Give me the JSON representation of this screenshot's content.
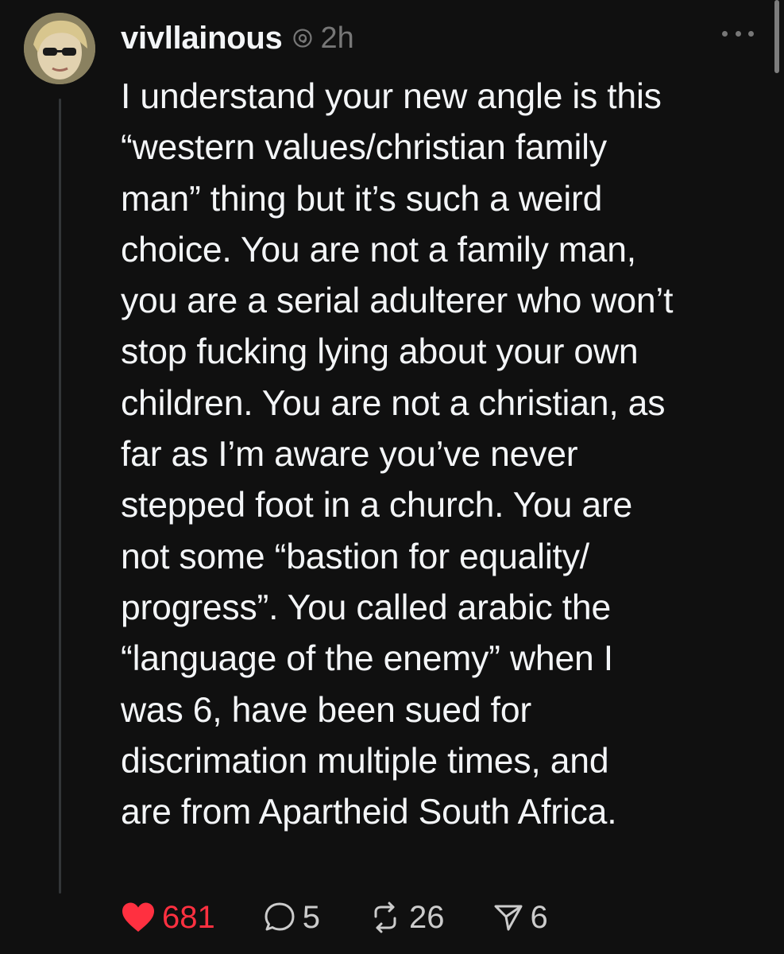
{
  "post": {
    "username": "vivllainous",
    "timestamp": "2h",
    "text": "I understand your new angle is this\n“western values/christian family\nman” thing but it’s such a weird\nchoice. You are not a family man,\nyou are a serial adulterer who won’t\nstop fucking lying about your own\nchildren. You are not a christian, as\nfar as I’m aware you’ve never\nstepped foot in a church. You are\nnot some “bastion for equality/\nprogress”. You called arabic the\n“language of the enemy” when I\nwas 6, have been sued for\ndiscrimation multiple times, and\nare from Apartheid South Africa.",
    "actions": {
      "likes": "681",
      "replies": "5",
      "reposts": "26",
      "shares": "6"
    },
    "liked": true
  },
  "icons": {
    "like": "heart-icon",
    "reply": "speech-bubble-icon",
    "repost": "repost-icon",
    "share": "send-icon",
    "verified": "threads-badge-icon",
    "more": "more-dots-icon"
  },
  "colors": {
    "background": "#101010",
    "text": "#f3f5f7",
    "muted": "#777777",
    "like_active": "#ff3040",
    "thread_line": "#333638"
  }
}
